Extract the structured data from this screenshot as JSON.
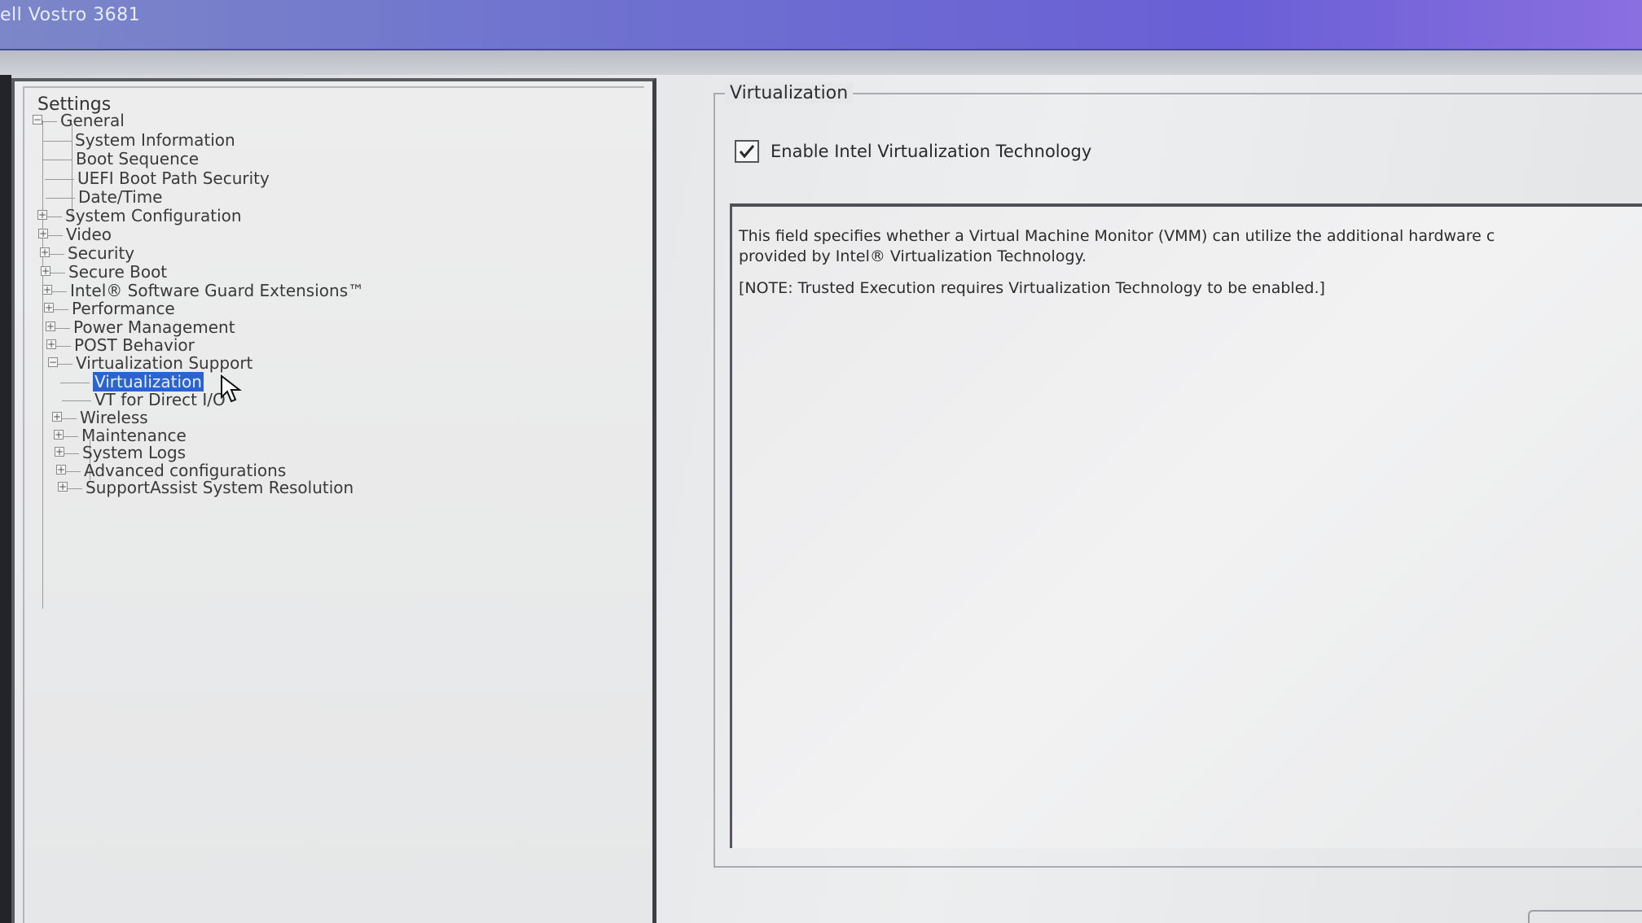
{
  "window": {
    "title": "ell Vostro 3681"
  },
  "tree": {
    "root_label": "Settings",
    "groups": [
      {
        "label": "General",
        "expanded": true,
        "children": [
          "System Information",
          "Boot Sequence",
          "UEFI Boot Path Security",
          "Date/Time"
        ]
      },
      {
        "label": "System Configuration",
        "expanded": false
      },
      {
        "label": "Video",
        "expanded": false
      },
      {
        "label": "Security",
        "expanded": false
      },
      {
        "label": "Secure Boot",
        "expanded": false
      },
      {
        "label": "Intel® Software Guard Extensions™",
        "expanded": false
      },
      {
        "label": "Performance",
        "expanded": false
      },
      {
        "label": "Power Management",
        "expanded": false
      },
      {
        "label": "POST Behavior",
        "expanded": false
      },
      {
        "label": "Virtualization Support",
        "expanded": true,
        "children": [
          "Virtualization",
          "VT for Direct I/O"
        ]
      },
      {
        "label": "Wireless",
        "expanded": false
      },
      {
        "label": "Maintenance",
        "expanded": false
      },
      {
        "label": "System Logs",
        "expanded": false
      },
      {
        "label": "Advanced configurations",
        "expanded": false
      },
      {
        "label": "SupportAssist System Resolution",
        "expanded": false
      }
    ],
    "selected": "Virtualization"
  },
  "detail": {
    "group_title": "Virtualization",
    "checkbox_label": "Enable Intel Virtualization Technology",
    "checkbox_checked": true,
    "description_line1": "This field specifies whether a Virtual Machine Monitor (VMM) can utilize the additional hardware c",
    "description_line2": "provided by Intel® Virtualization Technology.",
    "note": "[NOTE: Trusted Execution requires Virtualization Technology to be enabled.]"
  },
  "colors": {
    "title_bar": "#6e6fd0",
    "selection": "#2b63d0"
  },
  "icons": {
    "expand": "plus-box-icon",
    "collapse": "minus-box-icon",
    "check": "checkmark-icon",
    "cursor": "mouse-pointer-icon"
  }
}
